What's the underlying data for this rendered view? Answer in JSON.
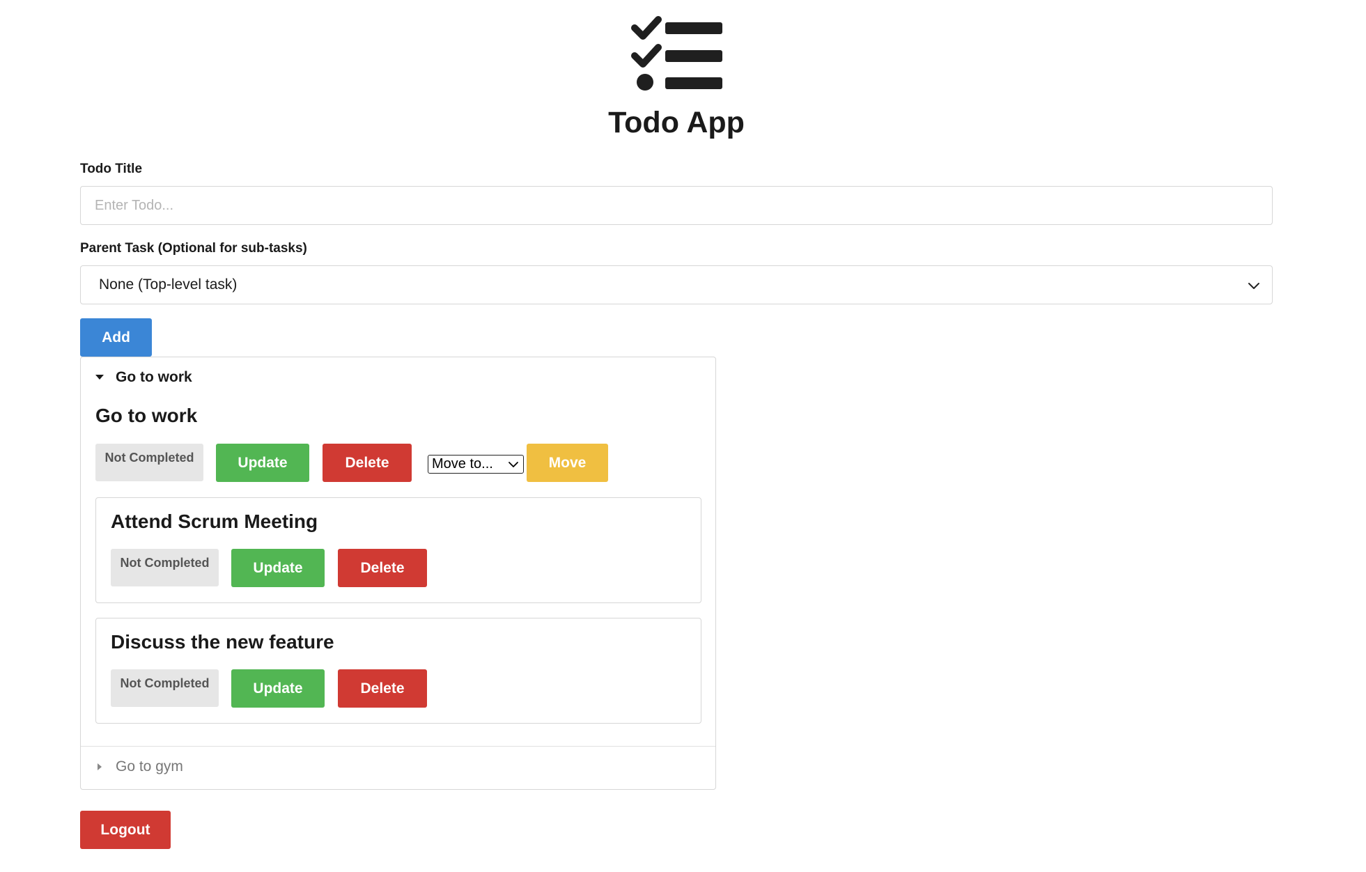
{
  "app": {
    "title": "Todo App",
    "logo_icon": "checklist-icon"
  },
  "form": {
    "title_label": "Todo Title",
    "title_placeholder": "Enter Todo...",
    "title_value": "",
    "parent_label": "Parent Task (Optional for sub-tasks)",
    "parent_selected": "None (Top-level task)",
    "add_label": "Add"
  },
  "todos": [
    {
      "summary": "Go to work",
      "expanded": true,
      "title": "Go to work",
      "status": "Not Completed",
      "update_label": "Update",
      "delete_label": "Delete",
      "move_selected": "Move to...",
      "move_label": "Move",
      "subtasks": [
        {
          "title": "Attend Scrum Meeting",
          "status": "Not Completed",
          "update_label": "Update",
          "delete_label": "Delete"
        },
        {
          "title": "Discuss the new feature",
          "status": "Not Completed",
          "update_label": "Update",
          "delete_label": "Delete"
        }
      ]
    },
    {
      "summary": "Go to gym",
      "expanded": false
    }
  ],
  "logout_label": "Logout",
  "colors": {
    "primary": "#3b86d6",
    "success": "#52b653",
    "danger": "#d03a33",
    "warning": "#f0bf41",
    "badge_bg": "#e6e6e6"
  }
}
